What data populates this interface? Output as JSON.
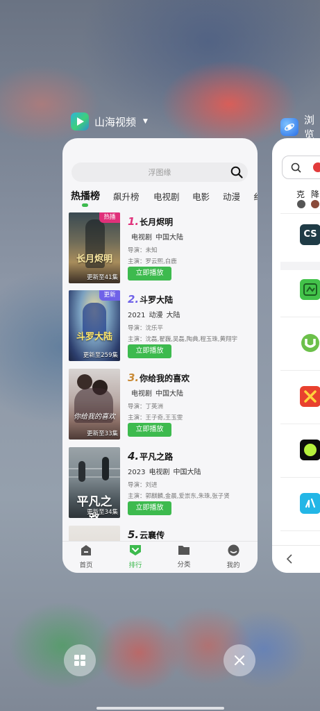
{
  "main_app": {
    "name": "山海视频"
  },
  "second_app": {
    "name": "浏览"
  },
  "search": {
    "placeholder": "浮图缘"
  },
  "tabs": [
    "热播榜",
    "飙升榜",
    "电视剧",
    "电影",
    "动漫",
    "纟"
  ],
  "items": [
    {
      "rank": "1.",
      "title": "长月烬明",
      "year": "",
      "genre": "电视剧",
      "region": "中国大陆",
      "director": "导演：未知",
      "cast": "主演：罗云熙,白鹿",
      "badge": "热播",
      "badge_color": "#e0307a",
      "poster_title": "长月烬明",
      "update": "更新至41集",
      "play": "立即播放",
      "rank_color": "#e0307a"
    },
    {
      "rank": "2.",
      "title": "斗罗大陆",
      "year": "2021",
      "genre": "动漫",
      "region": "大陆",
      "director": "导演：沈乐平",
      "cast": "主演：沈磊,翟巍,吴磊,陶典,程玉珠,黄翔宇",
      "badge": "更新",
      "badge_color": "#6f62e8",
      "poster_title": "斗罗大陆",
      "update": "更新至259集",
      "play": "立即播放",
      "rank_color": "#6f62e8"
    },
    {
      "rank": "3.",
      "title": "你给我的喜欢",
      "year": "",
      "genre": "电视剧",
      "region": "中国大陆",
      "director": "导演：丁英洲",
      "cast": "主演：王子奇,王玉雯",
      "badge": "",
      "badge_color": "",
      "poster_title": "你给我的喜欢",
      "update": "更新至33集",
      "play": "立即播放",
      "rank_color": "#c98a36"
    },
    {
      "rank": "4.",
      "title": "平凡之路",
      "year": "2023",
      "genre": "电视剧",
      "region": "中国大陆",
      "director": "导演：刘进",
      "cast": "主演：郭麒麟,金晨,爱崇东,朱珠,张子贤",
      "badge": "",
      "badge_color": "",
      "poster_title": "平凡之路",
      "update": "更新至34集",
      "play": "立即播放",
      "rank_color": "#222222"
    },
    {
      "rank": "5.",
      "title": "云襄传",
      "year": "",
      "genre": "",
      "region": "",
      "director": "",
      "cast": "",
      "badge": "",
      "badge_color": "",
      "poster_title": "",
      "update": "",
      "play": "",
      "rank_color": "#222222"
    }
  ],
  "bottom_nav": [
    "首页",
    "排行",
    "分类",
    "我的"
  ],
  "second_card": {
    "chars": "克降"
  },
  "colors": {
    "accent": "#3dba4e",
    "card_bg": "#f6f6f8"
  }
}
